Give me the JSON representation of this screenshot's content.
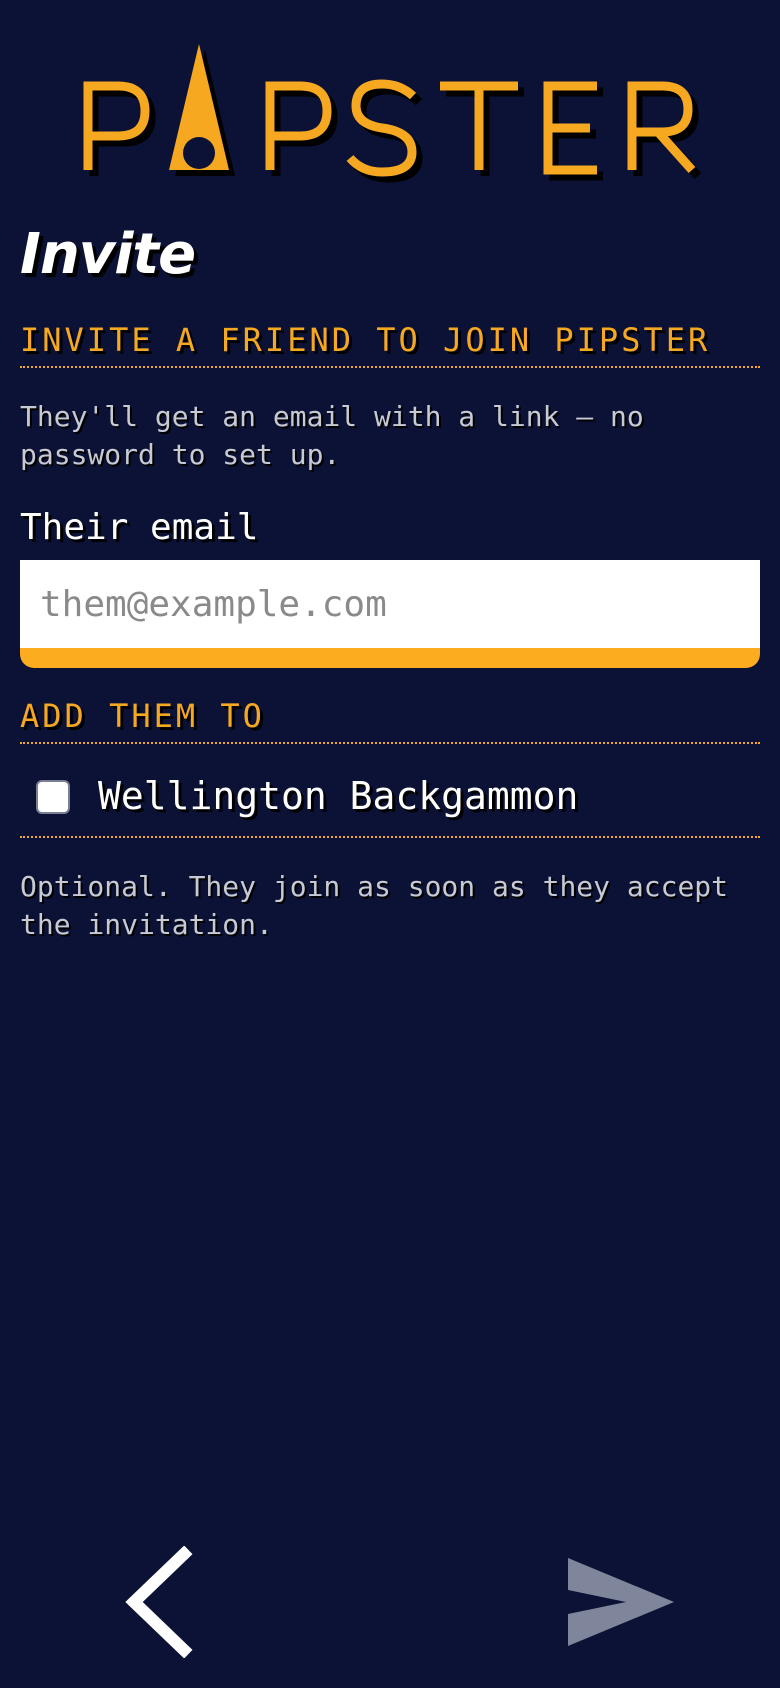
{
  "app": {
    "logo_text": "PIPSTER"
  },
  "page": {
    "title": "Invite"
  },
  "invite": {
    "heading": "INVITE A FRIEND TO JOIN PIPSTER",
    "description": "They'll get an email with a link — no password to set up.",
    "email_label": "Their email",
    "email_placeholder": "them@example.com",
    "email_value": ""
  },
  "teams": {
    "heading": "ADD THEM TO",
    "items": [
      {
        "label": "Wellington Backgammon",
        "checked": false
      }
    ],
    "note": "Optional. They join as soon as they accept the invitation."
  },
  "nav": {
    "back_icon": "chevron-left-icon",
    "send_icon": "send-arrow-icon"
  },
  "colors": {
    "background": "#0b1236",
    "accent": "#f6a821",
    "text": "#ffffff",
    "muted": "#c7c9d3",
    "disabled": "#7f859a"
  }
}
